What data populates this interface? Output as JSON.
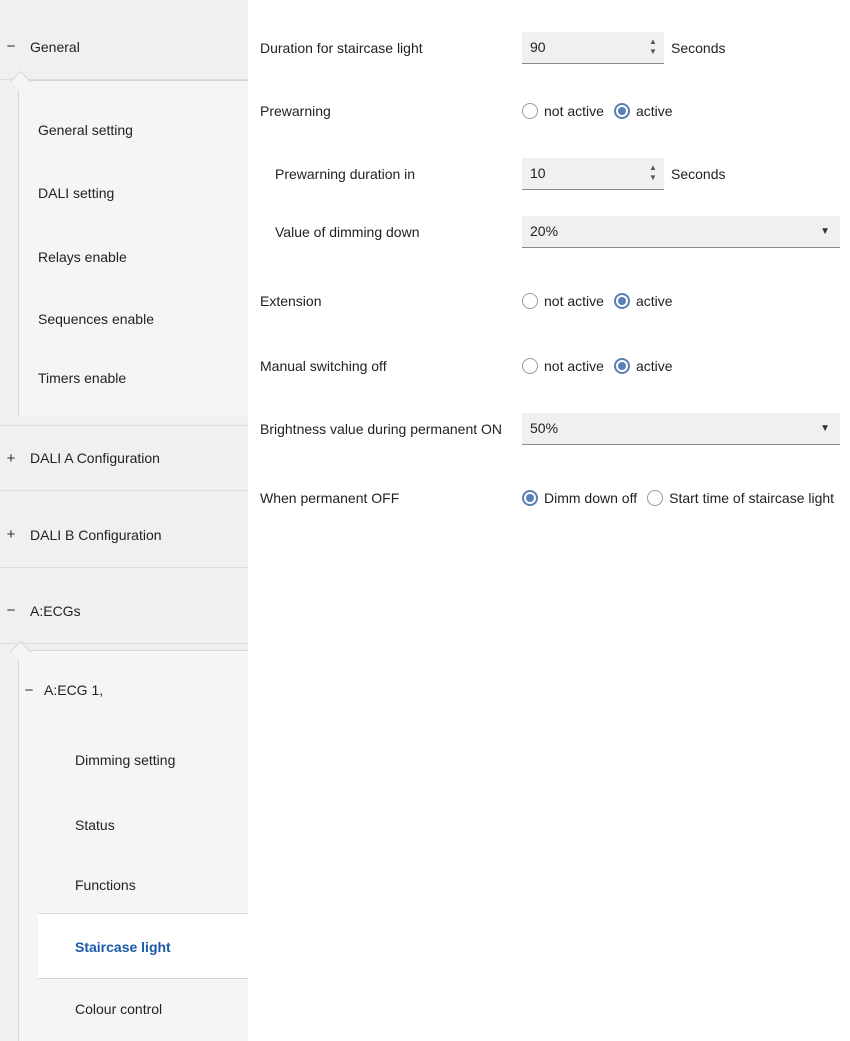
{
  "sidebar": {
    "general": {
      "sign": "−",
      "label": "General"
    },
    "general_items": [
      {
        "label": "General setting"
      },
      {
        "label": "DALI setting"
      },
      {
        "label": "Relays enable"
      },
      {
        "label": "Sequences enable"
      },
      {
        "label": "Timers enable"
      }
    ],
    "dali_a": {
      "sign": "+",
      "label": "DALI A Configuration"
    },
    "dali_b": {
      "sign": "+",
      "label": "DALI B Configuration"
    },
    "aecgs": {
      "sign": "−",
      "label": "A:ECGs"
    },
    "aecg1": {
      "sign": "−",
      "label": "A:ECG 1,"
    },
    "aecg1_items": [
      {
        "label": "Dimming setting"
      },
      {
        "label": "Status"
      },
      {
        "label": "Functions"
      },
      {
        "label": "Staircase light",
        "active": true
      },
      {
        "label": "Colour control"
      }
    ]
  },
  "form": {
    "duration": {
      "label": "Duration for staircase light",
      "value": "90",
      "unit": "Seconds"
    },
    "prewarning": {
      "label": "Prewarning",
      "options": [
        "not active",
        "active"
      ],
      "selected": "active"
    },
    "prewarning_duration": {
      "label": "Prewarning duration in",
      "value": "10",
      "unit": "Seconds"
    },
    "dimming_down": {
      "label": "Value of dimming down",
      "value": "20%"
    },
    "extension": {
      "label": "Extension",
      "options": [
        "not active",
        "active"
      ],
      "selected": "active"
    },
    "manual_off": {
      "label": "Manual switching off",
      "options": [
        "not active",
        "active"
      ],
      "selected": "active"
    },
    "brightness_on": {
      "label": "Brightness value during permanent ON",
      "value": "50%"
    },
    "permanent_off": {
      "label": "When permanent OFF",
      "options": [
        "Dimm down off",
        "Start time of staircase light"
      ],
      "selected": "Dimm down off"
    }
  },
  "icons": {
    "spin_up": "▲",
    "spin_down": "▼",
    "dropdown_caret": "▼"
  },
  "colors": {
    "active_item_text": "#1a5aa6",
    "radio_selected": "#5a7fb5",
    "sidebar_bg": "#f0f0f0"
  }
}
